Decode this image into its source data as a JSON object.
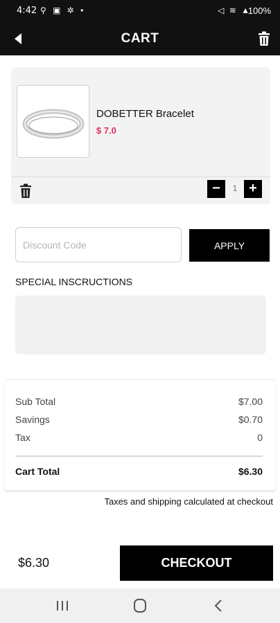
{
  "status_bar": {
    "time": "4:42",
    "battery": "100%"
  },
  "header": {
    "title": "CART"
  },
  "cart": {
    "items": [
      {
        "name": "DOBETTER Bracelet",
        "price": "$ 7.0",
        "quantity": "1"
      }
    ]
  },
  "discount": {
    "placeholder": "Discount Code",
    "apply_label": "APPLY"
  },
  "special": {
    "label": "SPECIAL INSCRUCTIONS"
  },
  "summary": {
    "subtotal_label": "Sub Total",
    "subtotal_value": "$7.00",
    "savings_label": "Savings",
    "savings_value": "$0.70",
    "tax_label": "Tax",
    "tax_value": "0",
    "total_label": "Cart Total",
    "total_value": "$6.30"
  },
  "tax_note": "Taxes and shipping calculated at checkout",
  "footer": {
    "total": "$6.30",
    "checkout_label": "CHECKOUT"
  },
  "colors": {
    "price": "#e0325d",
    "bar": "#111111",
    "button": "#000000"
  }
}
